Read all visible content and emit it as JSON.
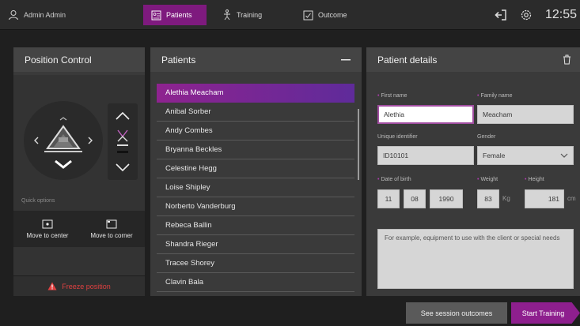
{
  "topbar": {
    "user_name": "Admin Admin",
    "tabs": [
      {
        "label": "Patients",
        "active": true
      },
      {
        "label": "Training",
        "active": false
      },
      {
        "label": "Outcome",
        "active": false
      }
    ],
    "time": "12:55",
    "icons": [
      "user-icon",
      "patients-icon",
      "training-icon",
      "outcome-icon",
      "logout-icon",
      "settings-icon"
    ]
  },
  "position_control": {
    "title": "Position Control",
    "quick_options_label": "Quick options",
    "move_to_center": "Move to center",
    "move_to_corner": "Move to corner",
    "freeze_label": "Freeze position"
  },
  "patients": {
    "title": "Patients",
    "items": [
      "Alethia Meacham",
      "Anibal Sorber",
      "Andy Combes",
      "Bryanna Beckles",
      "Celestine Hegg",
      "Loise Shipley",
      "Norberto Vanderburg",
      "Rebeca Ballin",
      "Shandra Rieger",
      "Tracee Shorey",
      "Clavin Bala"
    ],
    "selected_index": 0
  },
  "details": {
    "title": "Patient details",
    "first_name_label": "First name",
    "first_name": "Alethia",
    "family_name_label": "Family name",
    "family_name": "Meacham",
    "unique_id_label": "Unique identifier",
    "unique_id": "ID10101",
    "gender_label": "Gender",
    "gender": "Female",
    "dob_label": "Date of birth",
    "dob_day": "11",
    "dob_month": "08",
    "dob_year": "1990",
    "weight_label": "Weight",
    "weight": "83",
    "weight_unit": "Kg",
    "height_label": "Height",
    "height": "181",
    "height_unit": "cm",
    "notes_placeholder": "For example, equipment to use with the client or special needs"
  },
  "footer": {
    "see_outcomes": "See session outcomes",
    "start_training": "Start Training"
  },
  "colors": {
    "accent": "#8e1f8e",
    "background": "#1f1f1f",
    "panel": "#3a3a3a",
    "danger": "#e04040"
  }
}
